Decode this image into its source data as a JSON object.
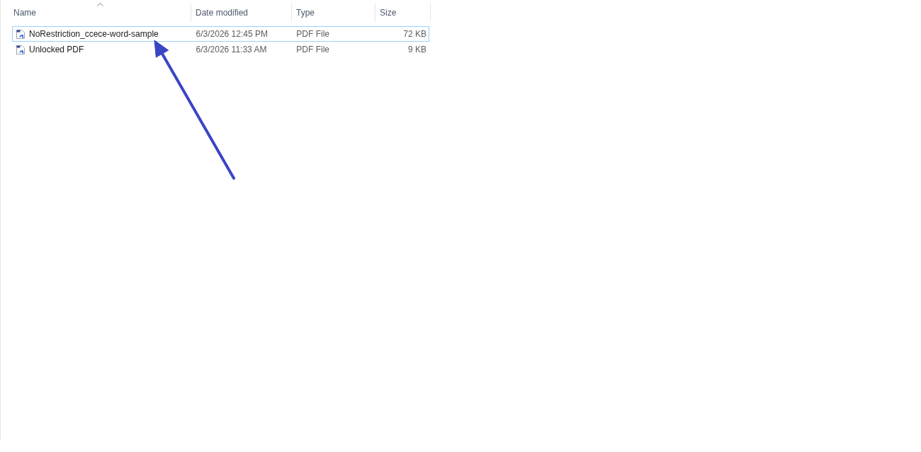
{
  "columns": [
    {
      "label": "Name",
      "sorted": true
    },
    {
      "label": "Date modified",
      "sorted": false
    },
    {
      "label": "Type",
      "sorted": false
    },
    {
      "label": "Size",
      "sorted": false
    }
  ],
  "files": [
    {
      "name": "NoRestriction_ccece-word-sample",
      "date_modified": "6/3/2026 12:45 PM",
      "type": "PDF File",
      "size": "72 KB",
      "focused": true,
      "selected": false
    },
    {
      "name": "Unlocked PDF",
      "date_modified": "6/3/2026 11:33 AM",
      "type": "PDF File",
      "size": "9 KB",
      "focused": false,
      "selected": false
    }
  ],
  "annotations": [
    {
      "kind": "arrow"
    }
  ]
}
